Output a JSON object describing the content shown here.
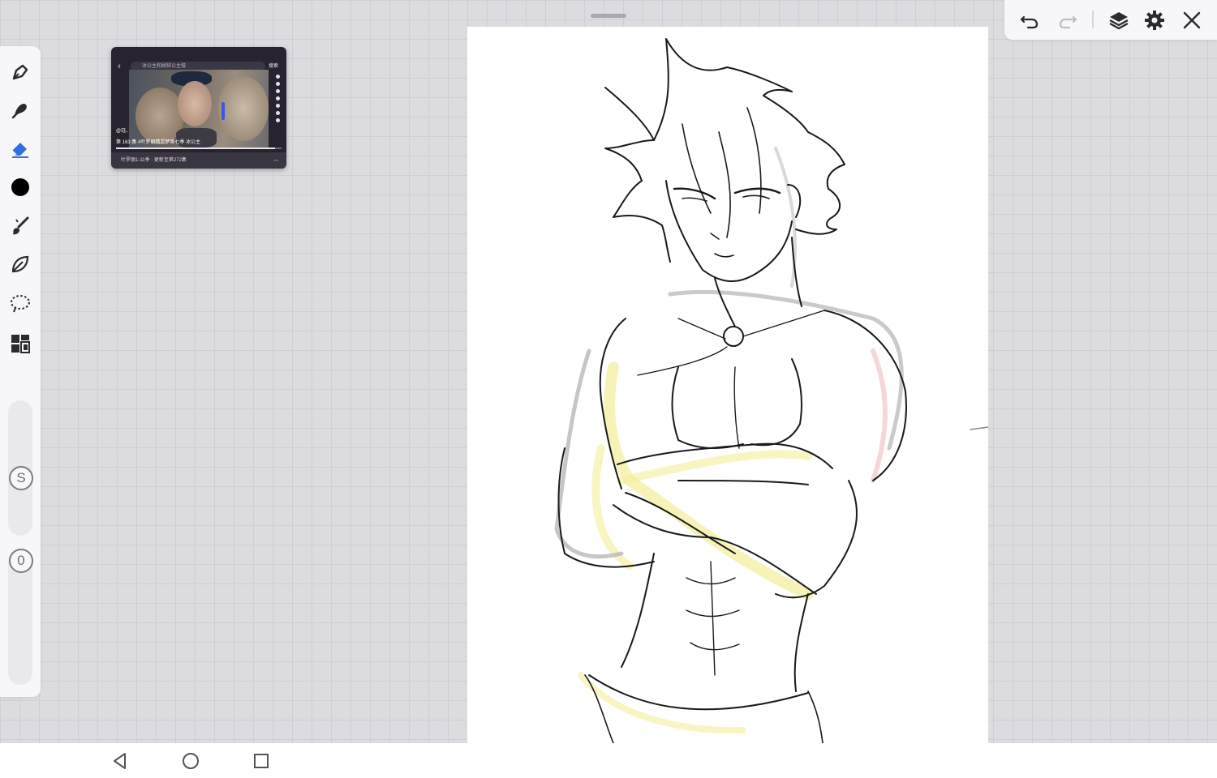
{
  "reference_window": {
    "search_text": "冰公主和顾辞公主做",
    "search_button": "搜索",
    "channel_label": "@珏..",
    "episode_caption": "第 163 集  #叶罗丽精灵梦第七季 冰公主",
    "footer_text": "叶罗丽1-11季 · 更新至第272集",
    "progress_fraction": 0.96
  },
  "toolbar": {
    "tools": [
      "pen-tool",
      "smudge-tool",
      "eraser-tool",
      "color-swatch",
      "brush-library",
      "liquify-tool",
      "lasso-select",
      "gallery-grid"
    ],
    "active_tool": "eraser-tool",
    "current_color": "#000000",
    "active_color": "#2f6fe4",
    "size_slider_label": "S",
    "opacity_slider_label": "0"
  },
  "top_bar": {
    "icons": [
      "undo-icon",
      "redo-icon",
      "layers-icon",
      "settings-icon",
      "close-icon"
    ]
  },
  "nav_bar": {
    "icons": [
      "back-icon",
      "home-icon",
      "recents-icon"
    ]
  }
}
